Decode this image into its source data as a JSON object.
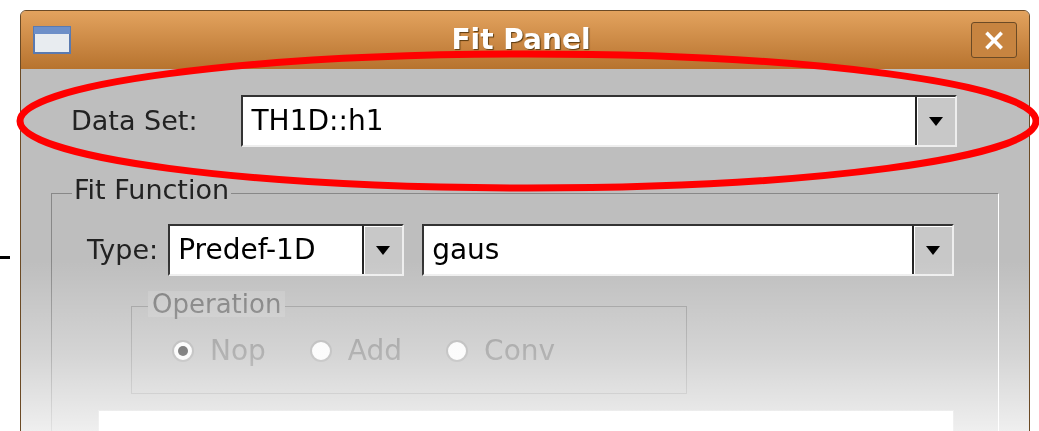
{
  "window": {
    "title": "Fit Panel",
    "close": "×"
  },
  "data_set": {
    "label": "Data Set:",
    "value": "TH1D::h1"
  },
  "fit_function": {
    "title": "Fit Function",
    "type_label": "Type:",
    "type_value": "Predef-1D",
    "function_value": "gaus",
    "operation": {
      "title": "Operation",
      "disabled": true,
      "options": [
        {
          "label": "Nop",
          "selected": true
        },
        {
          "label": "Add",
          "selected": false
        },
        {
          "label": "Conv",
          "selected": false
        }
      ]
    }
  }
}
